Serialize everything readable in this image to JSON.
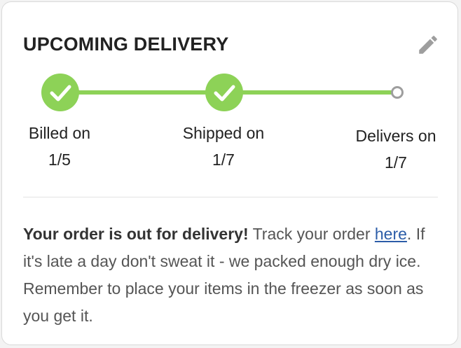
{
  "header": {
    "title": "UPCOMING DELIVERY",
    "edit_icon": "pencil-icon"
  },
  "tracker": {
    "accent_color": "#8dd257",
    "pending_color": "#9e9e9e",
    "steps": [
      {
        "label_line1": "Billed on",
        "label_line2": "1/5",
        "status": "complete",
        "icon": "check-icon"
      },
      {
        "label_line1": "Shipped on",
        "label_line2": "1/7",
        "status": "complete",
        "icon": "check-icon"
      },
      {
        "label_line1": "Delivers on",
        "label_line2": "1/7",
        "status": "pending",
        "icon": "circle-icon"
      }
    ]
  },
  "message": {
    "bold_text": "Your order is out for delivery!",
    "text_before_link": " Track your order ",
    "link_text": "here",
    "text_after_link": ". If it's late a day don't sweat it - we packed enough dry ice. Remember to place your items in the freezer as soon as you get it."
  }
}
